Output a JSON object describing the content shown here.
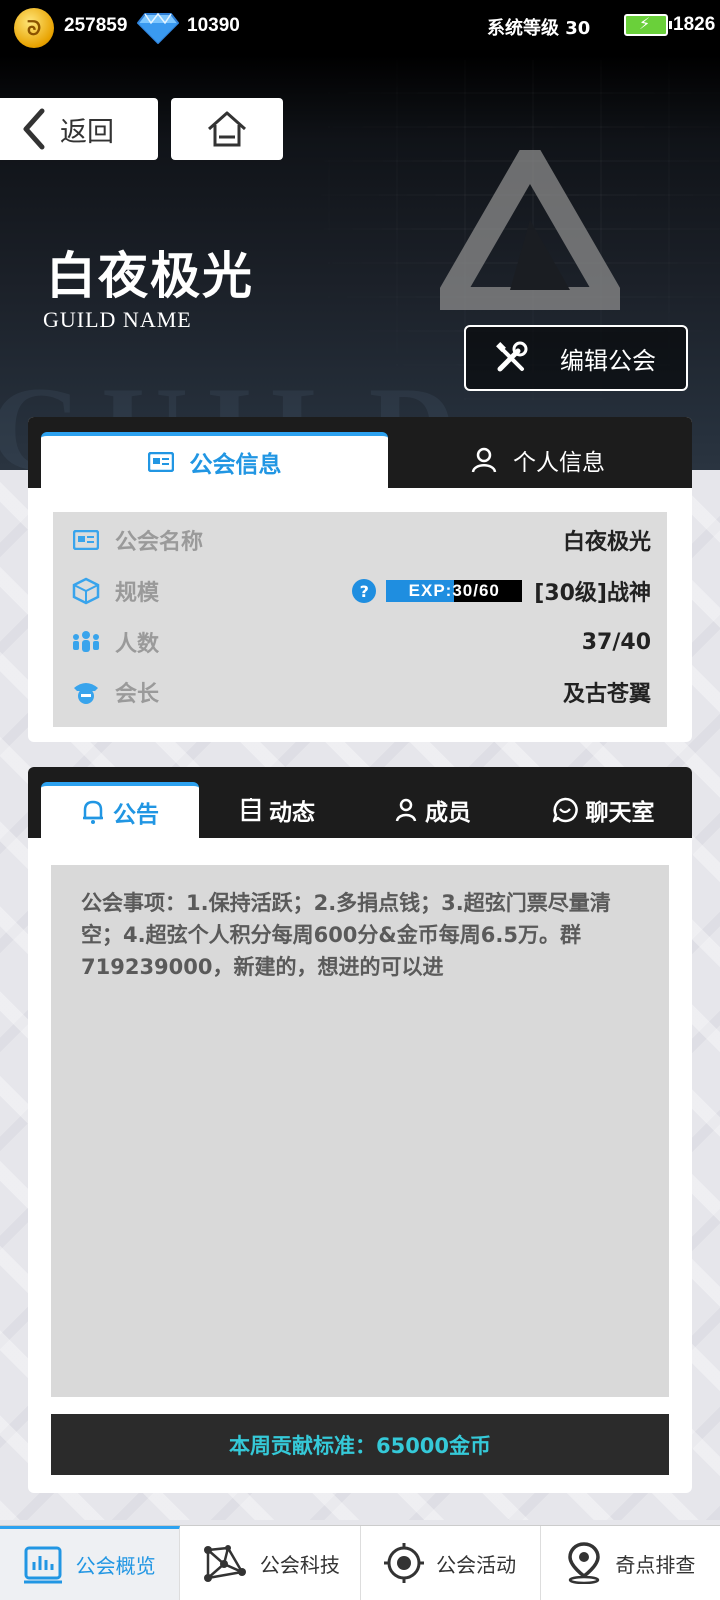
{
  "status": {
    "coins": "257859",
    "gems": "10390",
    "system_level": "系统等级 30",
    "energy": "1826"
  },
  "nav": {
    "back_label": "返回"
  },
  "guild": {
    "name": "白夜极光",
    "subtitle": "GUILD NAME",
    "edit_label": "编辑公会",
    "bg_text": "GUILD"
  },
  "info_tabs": {
    "tab1": "公会信息",
    "tab2": "个人信息"
  },
  "info": {
    "rows": [
      {
        "label": "公会名称",
        "value": "白夜极光"
      },
      {
        "label": "规模",
        "value": "[30级]战神"
      },
      {
        "label": "人数",
        "value": "37/40"
      },
      {
        "label": "会长",
        "value": "及古苍翼"
      }
    ],
    "exp_label": "EXP:30/60",
    "exp_fraction": 0.5,
    "help": "?"
  },
  "notice_tabs": {
    "t1": "公告",
    "t2": "动态",
    "t3": "成员",
    "t4": "聊天室"
  },
  "notice": {
    "text": "公会事项：1.保持活跃；2.多捐点钱；3.超弦门票尽量清空；4.超弦个人积分每周600分&金币每周6.5万。群719239000，新建的，想进的可以进",
    "contribution": "本周贡献标准：65000金币"
  },
  "bottom_nav": [
    {
      "label": "公会概览",
      "icon": "bar-chart-icon"
    },
    {
      "label": "公会科技",
      "icon": "network-icon"
    },
    {
      "label": "公会活动",
      "icon": "target-icon"
    },
    {
      "label": "奇点排查",
      "icon": "location-pin-icon"
    }
  ],
  "colors": {
    "accent": "#2196e3",
    "contribution_text": "#35c9d8"
  }
}
